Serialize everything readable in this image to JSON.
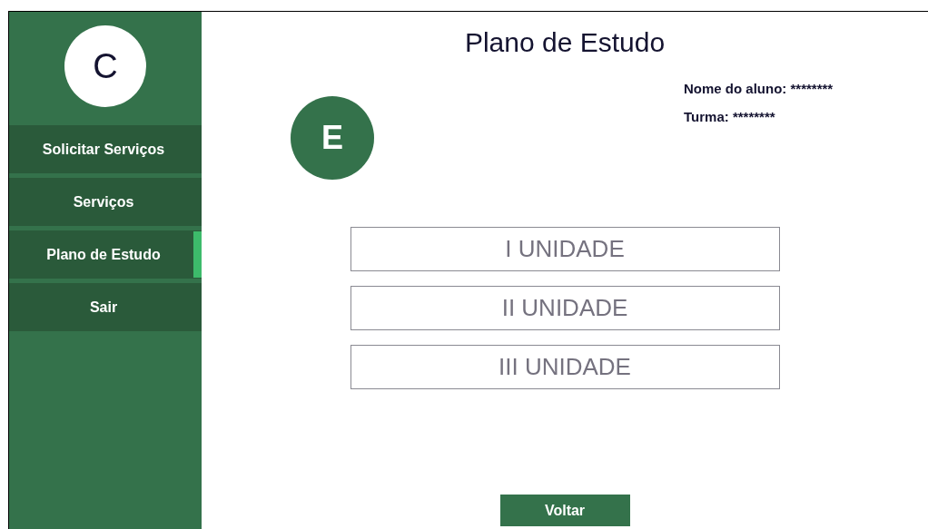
{
  "sidebar": {
    "avatar": "C",
    "items": [
      {
        "label": "Solicitar Serviços",
        "selected": false
      },
      {
        "label": "Serviços",
        "selected": false
      },
      {
        "label": "Plano de Estudo",
        "selected": true
      },
      {
        "label": "Sair",
        "selected": false
      }
    ]
  },
  "title": "Plano de Estudo",
  "student": {
    "avatar": "E",
    "name": "Nome do aluno: ********",
    "class": "Turma: ********"
  },
  "units": [
    "I UNIDADE",
    "II UNIDADE",
    "III UNIDADE"
  ],
  "back_button": "Voltar"
}
